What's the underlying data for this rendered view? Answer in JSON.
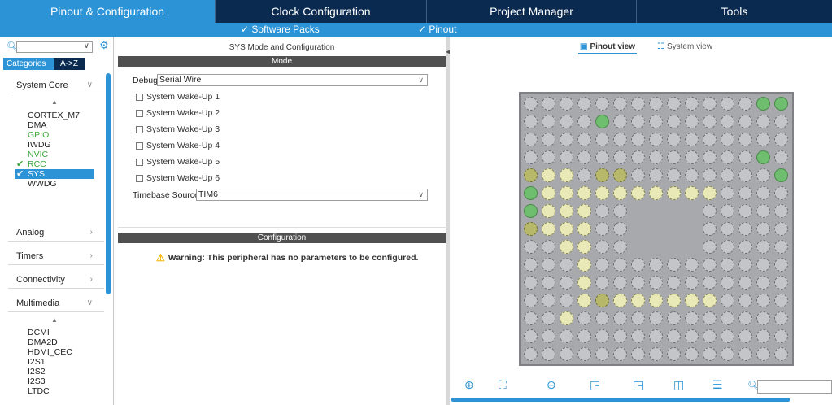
{
  "tabs": [
    {
      "label": "Pinout & Configuration",
      "active": true
    },
    {
      "label": "Clock Configuration",
      "active": false
    },
    {
      "label": "Project Manager",
      "active": false
    },
    {
      "label": "Tools",
      "active": false
    }
  ],
  "subbar": {
    "software_packs": "✓ Software Packs",
    "pinout": "✓ Pinout"
  },
  "sidebar": {
    "search_placeholder": "",
    "categories_tab": "Categories",
    "az_tab": "A->Z",
    "groups": {
      "system_core": "System Core",
      "analog": "Analog",
      "timers": "Timers",
      "connectivity": "Connectivity",
      "multimedia": "Multimedia"
    },
    "system_core_items": [
      "CORTEX_M7",
      "DMA",
      "GPIO",
      "IWDG",
      "NVIC",
      "RCC",
      "SYS",
      "WWDG"
    ],
    "multimedia_items": [
      "DCMI",
      "DMA2D",
      "HDMI_CEC",
      "I2S1",
      "I2S2",
      "I2S3",
      "LTDC"
    ]
  },
  "mode_panel": {
    "title": "SYS Mode and Configuration",
    "mode_header": "Mode",
    "debug_label": "Debug",
    "debug_value": "Serial Wire",
    "wakeups": [
      "System Wake-Up 1",
      "System Wake-Up 2",
      "System Wake-Up 3",
      "System Wake-Up 4",
      "System Wake-Up 5",
      "System Wake-Up 6"
    ],
    "timebase_label": "Timebase Source",
    "timebase_value": "TIM6",
    "config_header": "Configuration",
    "warning": "Warning: This peripheral has no parameters to be configured."
  },
  "pinout": {
    "pinout_view": "Pinout view",
    "system_view": "System view",
    "zoom_value": ""
  }
}
